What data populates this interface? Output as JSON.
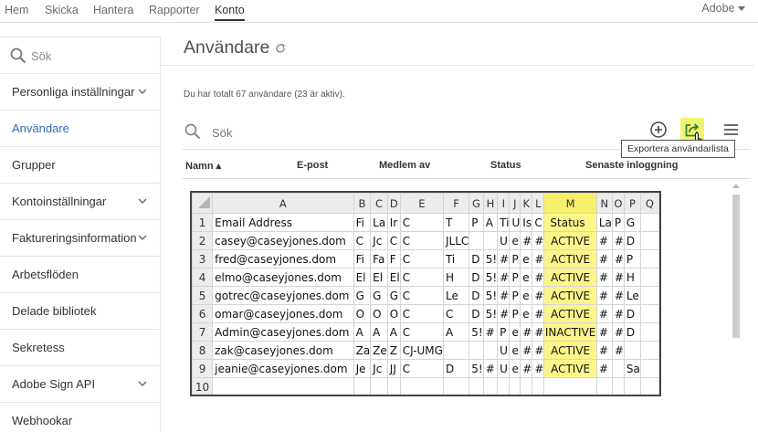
{
  "topnav": {
    "items": [
      "Hem",
      "Skicka",
      "Hantera",
      "Rapporter",
      "Konto"
    ],
    "active": "Konto",
    "account": "Adobe"
  },
  "sidebar": {
    "search_placeholder": "Sök",
    "items": [
      {
        "label": "Personliga inställningar",
        "expandable": true
      },
      {
        "label": "Användare",
        "expandable": false,
        "active": true
      },
      {
        "label": "Grupper",
        "expandable": false
      },
      {
        "label": "Kontoinställningar",
        "expandable": true
      },
      {
        "label": "Faktureringsinformation",
        "expandable": true
      },
      {
        "label": "Arbetsflöden",
        "expandable": false
      },
      {
        "label": "Delade bibliotek",
        "expandable": false
      },
      {
        "label": "Sekretess",
        "expandable": false
      },
      {
        "label": "Adobe Sign API",
        "expandable": true
      },
      {
        "label": "Webhookar",
        "expandable": false
      }
    ]
  },
  "main": {
    "title": "Användare",
    "total_text": "Du har totalt 67 användare (23 är aktiv).",
    "search_placeholder": "Sök",
    "tooltip": "Exportera användarlista",
    "columns": [
      "Namn ▴",
      "E-post",
      "Medlem av",
      "Status",
      "Senaste inloggning"
    ]
  },
  "spreadsheet": {
    "col_headers": [
      "A",
      "B",
      "C",
      "D",
      "E",
      "F",
      "G",
      "H",
      "I",
      "J",
      "K",
      "L",
      "M",
      "N",
      "O",
      "P",
      "Q"
    ],
    "rows": [
      [
        "Email Address",
        "Fi",
        "La",
        "Ir",
        "C",
        "T",
        "P",
        "A",
        "Ti",
        "U",
        "Is",
        "C",
        "Status",
        "La",
        "P",
        "G",
        ""
      ],
      [
        "casey@caseyjones.dom",
        "C",
        "Jc",
        "C",
        "C",
        "JLLC",
        "",
        "",
        "U",
        "e",
        "#",
        "#",
        "ACTIVE",
        "#",
        "#",
        "D",
        ""
      ],
      [
        "fred@caseyjones.dom",
        "Fi",
        "Fa",
        "F",
        "C",
        "Ti",
        "D",
        "5!",
        "#",
        "P",
        "e",
        "#",
        "ACTIVE",
        "#",
        "#",
        "P",
        ""
      ],
      [
        "elmo@caseyjones.dom",
        "El",
        "El",
        "El",
        "C",
        "H",
        "D",
        "5!",
        "#",
        "P",
        "e",
        "#",
        "ACTIVE",
        "#",
        "#",
        "H",
        ""
      ],
      [
        "gotrec@caseyjones.dom",
        "G",
        "G",
        "G",
        "C",
        "Le",
        "D",
        "5!",
        "#",
        "P",
        "e",
        "#",
        "ACTIVE",
        "#",
        "#",
        "Le",
        ""
      ],
      [
        "omar@caseyjones.dom",
        "O",
        "O",
        "O",
        "C",
        "C",
        "D",
        "5!",
        "#",
        "P",
        "e",
        "#",
        "ACTIVE",
        "#",
        "#",
        "D",
        ""
      ],
      [
        "Admin@caseyjones.dom",
        "A",
        "A",
        "A",
        "C",
        "A",
        "5!",
        "#",
        "P",
        "e",
        "#",
        "#",
        "INACTIVE",
        "#",
        "#",
        "D",
        ""
      ],
      [
        "zak@caseyjones.dom",
        "Za",
        "Ze",
        "Z",
        "CJ-UMG",
        "",
        "",
        "",
        "U",
        "e",
        "#",
        "#",
        "ACTIVE",
        "#",
        "#",
        "",
        ""
      ],
      [
        "jeanie@caseyjones.dom",
        "Je",
        "Jc",
        "JJ",
        "C",
        "D",
        "5!",
        "#",
        "U",
        "e",
        "#",
        "#",
        "ACTIVE",
        "#",
        "",
        "Sa",
        ""
      ],
      [
        "",
        "",
        "",
        "",
        "",
        "",
        "",
        "",
        "",
        "",
        "",
        "",
        "",
        "",
        "",
        "",
        ""
      ]
    ]
  }
}
